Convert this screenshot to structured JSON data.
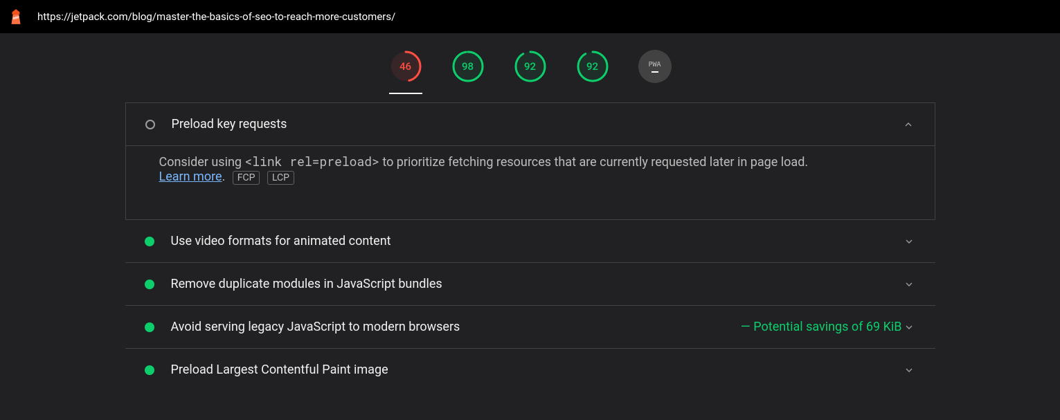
{
  "topbar": {
    "url": "https://jetpack.com/blog/master-the-basics-of-seo-to-reach-more-customers/"
  },
  "gauges": {
    "performance": {
      "score": 46,
      "color": "red",
      "pct": 0.46
    },
    "accessibility": {
      "score": 98,
      "color": "green",
      "pct": 0.98
    },
    "bestpractices": {
      "score": 92,
      "color": "green",
      "pct": 0.92
    },
    "seo": {
      "score": 92,
      "color": "green",
      "pct": 0.92
    },
    "pwa": {
      "label": "PWA"
    }
  },
  "expanded_audit": {
    "title": "Preload key requests",
    "status": "gray",
    "desc_before": "Consider using ",
    "desc_code": "<link rel=preload>",
    "desc_after": " to prioritize fetching resources that are currently requested later in page load. ",
    "learn_more": "Learn more",
    "tag1": "FCP",
    "tag2": "LCP"
  },
  "audits": [
    {
      "title": "Use video formats for animated content",
      "status": "green",
      "savings": ""
    },
    {
      "title": "Remove duplicate modules in JavaScript bundles",
      "status": "green",
      "savings": ""
    },
    {
      "title": "Avoid serving legacy JavaScript to modern browsers",
      "status": "green",
      "savings": "Potential savings of 69 KiB"
    },
    {
      "title": "Preload Largest Contentful Paint image",
      "status": "green",
      "savings": ""
    }
  ]
}
